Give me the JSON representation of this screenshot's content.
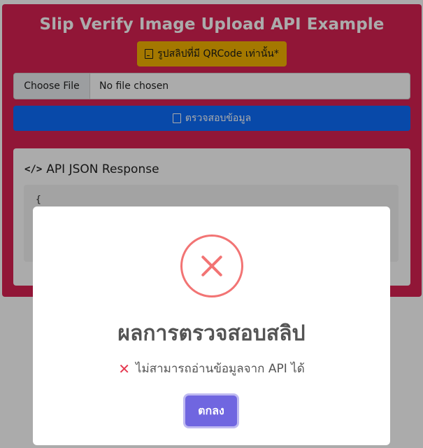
{
  "page": {
    "title": "Slip Verify Image Upload API Example",
    "badge_label": "รูปสลิปที่มี QRCode เท่านั้น*",
    "file_button_label": "Choose File",
    "file_status_text": "No file chosen",
    "submit_label": "ตรวจสอบข้อมูล",
    "response_title": "API JSON Response",
    "response_code": "{"
  },
  "modal": {
    "title": "ผลการตรวจสอบสลิป",
    "message": "ไม่สามารถอ่านข้อมูลจาก API ได้",
    "ok_label": "ตกลง",
    "icon": "error-x-icon"
  },
  "colors": {
    "card_bg": "#d92153",
    "badge_bg": "#f5b400",
    "submit_bg": "#0d6efd",
    "error_icon": "#f27474",
    "ok_button": "#7066e0"
  }
}
